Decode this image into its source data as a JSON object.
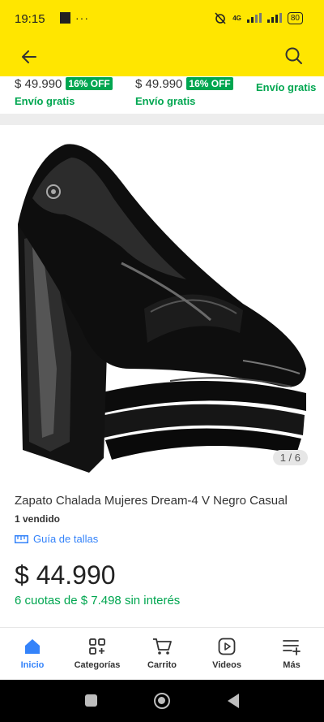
{
  "status": {
    "time": "19:15",
    "dots": "···",
    "network": "4G",
    "battery": "80"
  },
  "carousel": [
    {
      "price": "$ 49.990",
      "discount": "16% OFF",
      "shipping": "Envío gratis"
    },
    {
      "price": "$ 49.990",
      "discount": "16% OFF",
      "shipping": "Envío gratis"
    },
    {
      "shipping": "Envío gratis"
    }
  ],
  "gallery": {
    "counter": "1 / 6"
  },
  "product": {
    "title": "Zapato Chalada Mujeres Dream-4 V Negro Casual",
    "sold": "1 vendido",
    "size_guide": "Guía de tallas",
    "price": "$ 44.990",
    "installments": "6 cuotas de $ 7.498 sin interés"
  },
  "tabs": [
    {
      "label": "Inicio",
      "icon": "home-icon",
      "active": true
    },
    {
      "label": "Categorías",
      "icon": "categories-icon"
    },
    {
      "label": "Carrito",
      "icon": "cart-icon"
    },
    {
      "label": "Videos",
      "icon": "video-icon"
    },
    {
      "label": "Más",
      "icon": "more-icon"
    }
  ],
  "colors": {
    "brand_yellow": "#ffe600",
    "accent_blue": "#3483fa",
    "green": "#00a650"
  }
}
